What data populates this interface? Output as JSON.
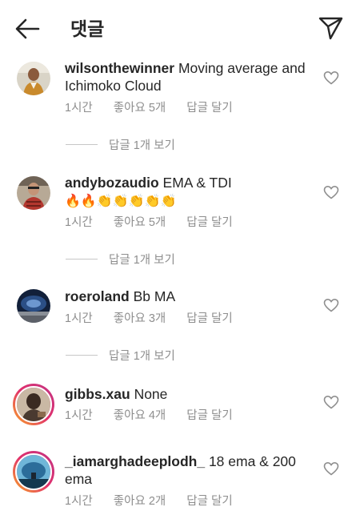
{
  "header": {
    "title": "댓글",
    "back_icon": "arrow-left-icon",
    "send_icon": "paper-plane-icon"
  },
  "comments": [
    {
      "username": "wilsonthewinner",
      "text": "Moving average and Ichimoko Cloud",
      "time": "1시간",
      "likes": "좋아요 5개",
      "reply": "답글 달기",
      "view_replies": "답글 1개 보기"
    },
    {
      "username": "andybozaudio",
      "text": "EMA & TDI",
      "emoji": "🔥🔥👏👏👏👏👏",
      "time": "1시간",
      "likes": "좋아요 5개",
      "reply": "답글 달기",
      "view_replies": "답글 1개 보기"
    },
    {
      "username": "roeroland",
      "text": "Bb MA",
      "time": "1시간",
      "likes": "좋아요 3개",
      "reply": "답글 달기",
      "view_replies": "답글 1개 보기"
    },
    {
      "username": "gibbs.xau",
      "text": "None",
      "time": "1시간",
      "likes": "좋아요 4개",
      "reply": "답글 달기"
    },
    {
      "username": "_iamarghadeeplodh_",
      "text": "18 ema & 200 ema",
      "time": "1시간",
      "likes": "좋아요 2개",
      "reply": "답글 달기"
    }
  ],
  "colors": {
    "text": "#262626",
    "muted": "#8e8e8e",
    "story_ring_start": "#f9a825",
    "story_ring_end": "#c13584"
  }
}
